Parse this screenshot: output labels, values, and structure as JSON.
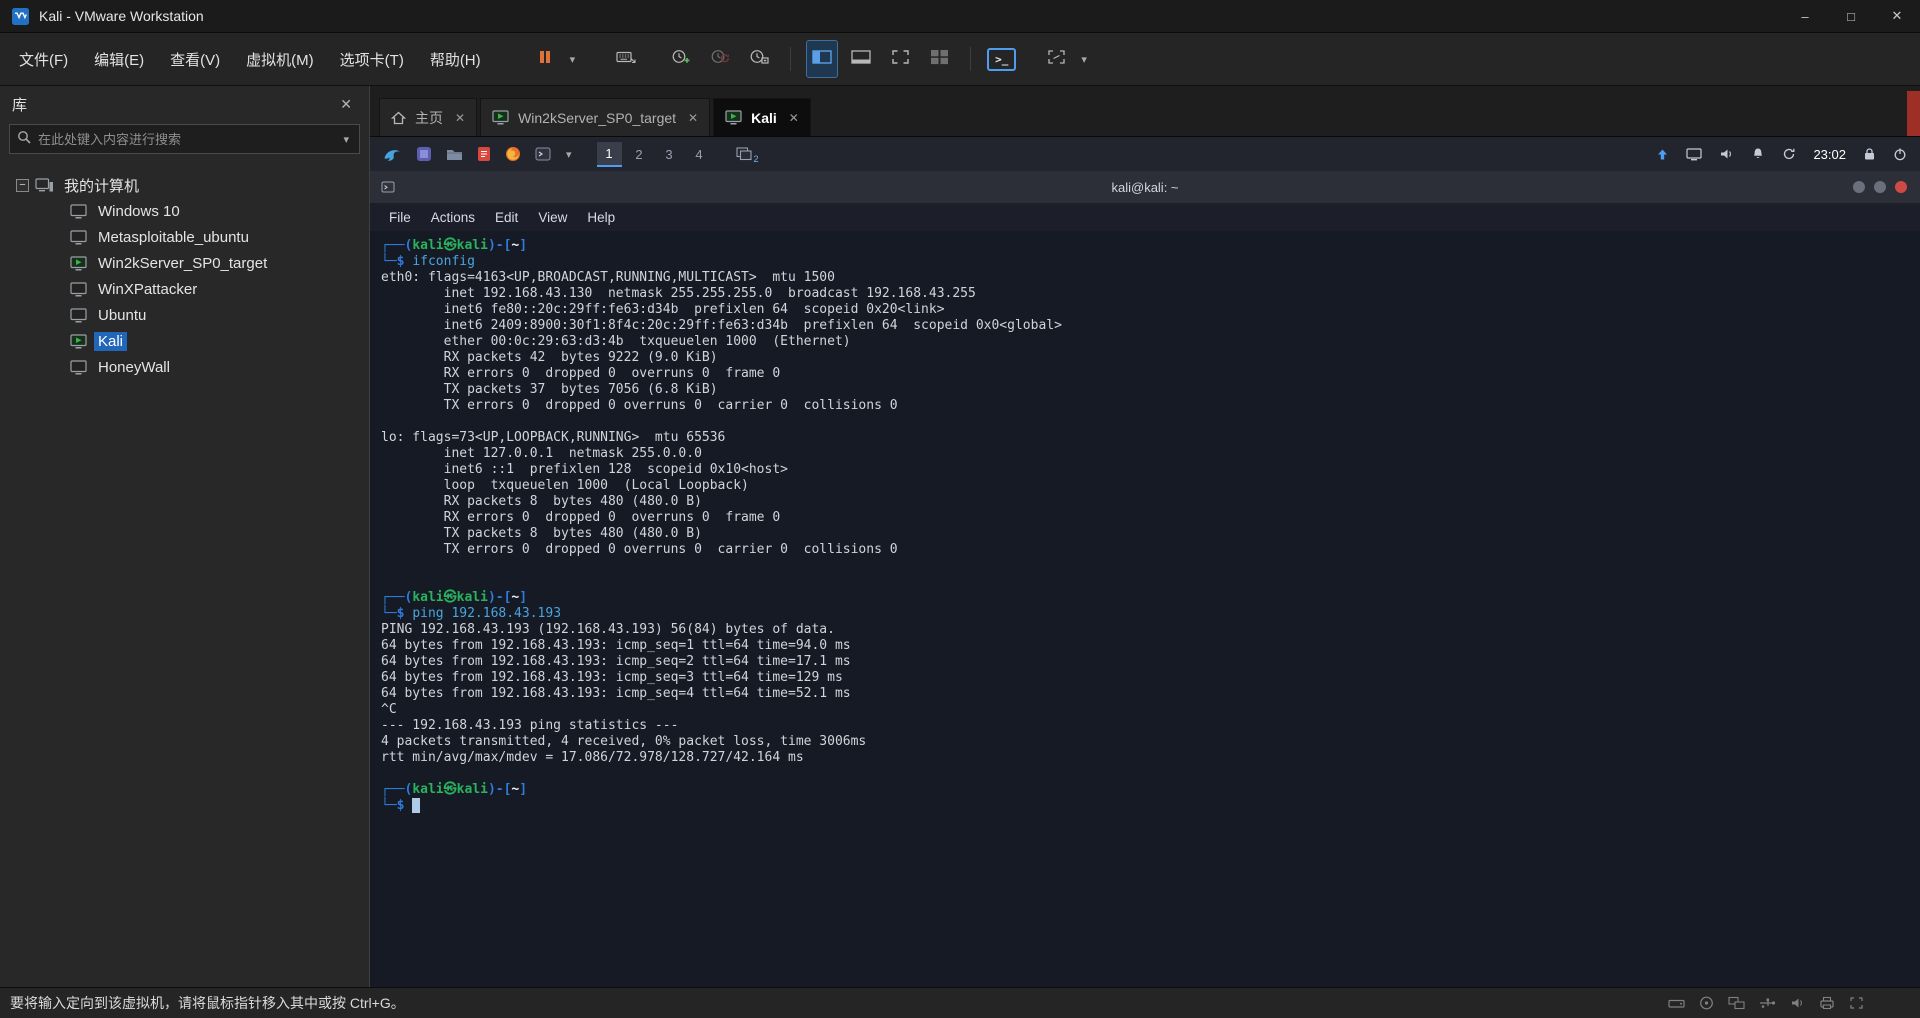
{
  "window": {
    "title": "Kali - VMware Workstation"
  },
  "icons": {
    "close": "✕",
    "minimize": "–",
    "maximize": "□",
    "dropdown": "▾",
    "expander": "−",
    "console": ">_"
  },
  "menubar": {
    "items": [
      {
        "name": "file",
        "label": "文件(F)"
      },
      {
        "name": "edit",
        "label": "编辑(E)"
      },
      {
        "name": "view",
        "label": "查看(V)"
      },
      {
        "name": "vm",
        "label": "虚拟机(M)"
      },
      {
        "name": "tabs",
        "label": "选项卡(T)"
      },
      {
        "name": "help",
        "label": "帮助(H)"
      }
    ]
  },
  "toolbar": {
    "buttons": [
      "suspend",
      "suspend-menu",
      "send-ctrl-alt-del",
      "take-snapshot",
      "revert-snapshot",
      "snapshot-manager",
      "show-library",
      "show-thumbnail-bar",
      "fit-guest",
      "unity-mode",
      "console-view",
      "fullscreen",
      "fullscreen-menu"
    ]
  },
  "sidebar": {
    "title": "库",
    "search_placeholder": "在此处键入内容进行搜索",
    "tree_root": "我的计算机",
    "items": [
      {
        "label": "Windows 10",
        "running": false,
        "selected": false
      },
      {
        "label": "Metasploitable_ubuntu",
        "running": false,
        "selected": false
      },
      {
        "label": "Win2kServer_SP0_target",
        "running": true,
        "selected": false
      },
      {
        "label": "WinXPattacker",
        "running": false,
        "selected": false
      },
      {
        "label": "Ubuntu",
        "running": false,
        "selected": false
      },
      {
        "label": "Kali",
        "running": true,
        "selected": true
      },
      {
        "label": "HoneyWall",
        "running": false,
        "selected": false
      }
    ]
  },
  "tabs": [
    {
      "name": "home",
      "label": "主页",
      "icon": "home",
      "active": false
    },
    {
      "name": "win2kserver-sp0-target",
      "label": "Win2kServer_SP0_target",
      "icon": "vm-running",
      "active": false
    },
    {
      "name": "kali",
      "label": "Kali",
      "icon": "vm-running",
      "active": true
    }
  ],
  "guest": {
    "panel": {
      "left_icon_names": [
        "kali-menu-icon",
        "workspaces-app-icon",
        "file-manager-icon",
        "text-editor-icon",
        "firefox-icon",
        "terminal-app-icon",
        "apps-chevron-icon",
        "window-list-icon"
      ],
      "right_icon_names": [
        "upload-icon",
        "display-icon",
        "volume-icon",
        "bell-icon",
        "update-icon",
        "lock-icon",
        "power-icon"
      ],
      "workspaces": [
        "1",
        "2",
        "3",
        "4"
      ],
      "active_workspace": "1",
      "window_badge": "2",
      "clock": "23:02"
    },
    "terminal": {
      "title": "kali@kali: ~",
      "menu": [
        "File",
        "Actions",
        "Edit",
        "View",
        "Help"
      ],
      "lines": [
        [
          [
            "b",
            "┌──("
          ],
          [
            "g",
            "kali㉿kali"
          ],
          [
            "b",
            ")-["
          ],
          [
            "w",
            "~"
          ],
          [
            "b",
            "]"
          ]
        ],
        [
          [
            "b",
            "└─$"
          ],
          [
            "o",
            " "
          ],
          [
            "c",
            "ifconfig"
          ]
        ],
        [
          [
            "o",
            "eth0: flags=4163<UP,BROADCAST,RUNNING,MULTICAST>  mtu 1500"
          ]
        ],
        [
          [
            "o",
            "        inet 192.168.43.130  netmask 255.255.255.0  broadcast 192.168.43.255"
          ]
        ],
        [
          [
            "o",
            "        inet6 fe80::20c:29ff:fe63:d34b  prefixlen 64  scopeid 0x20<link>"
          ]
        ],
        [
          [
            "o",
            "        inet6 2409:8900:30f1:8f4c:20c:29ff:fe63:d34b  prefixlen 64  scopeid 0x0<global>"
          ]
        ],
        [
          [
            "o",
            "        ether 00:0c:29:63:d3:4b  txqueuelen 1000  (Ethernet)"
          ]
        ],
        [
          [
            "o",
            "        RX packets 42  bytes 9222 (9.0 KiB)"
          ]
        ],
        [
          [
            "o",
            "        RX errors 0  dropped 0  overruns 0  frame 0"
          ]
        ],
        [
          [
            "o",
            "        TX packets 37  bytes 7056 (6.8 KiB)"
          ]
        ],
        [
          [
            "o",
            "        TX errors 0  dropped 0 overruns 0  carrier 0  collisions 0"
          ]
        ],
        [],
        [
          [
            "o",
            "lo: flags=73<UP,LOOPBACK,RUNNING>  mtu 65536"
          ]
        ],
        [
          [
            "o",
            "        inet 127.0.0.1  netmask 255.0.0.0"
          ]
        ],
        [
          [
            "o",
            "        inet6 ::1  prefixlen 128  scopeid 0x10<host>"
          ]
        ],
        [
          [
            "o",
            "        loop  txqueuelen 1000  (Local Loopback)"
          ]
        ],
        [
          [
            "o",
            "        RX packets 8  bytes 480 (480.0 B)"
          ]
        ],
        [
          [
            "o",
            "        RX errors 0  dropped 0  overruns 0  frame 0"
          ]
        ],
        [
          [
            "o",
            "        TX packets 8  bytes 480 (480.0 B)"
          ]
        ],
        [
          [
            "o",
            "        TX errors 0  dropped 0 overruns 0  carrier 0  collisions 0"
          ]
        ],
        [],
        [],
        [
          [
            "b",
            "┌──("
          ],
          [
            "g",
            "kali㉿kali"
          ],
          [
            "b",
            ")-["
          ],
          [
            "w",
            "~"
          ],
          [
            "b",
            "]"
          ]
        ],
        [
          [
            "b",
            "└─$"
          ],
          [
            "o",
            " "
          ],
          [
            "c",
            "ping 192.168.43.193"
          ]
        ],
        [
          [
            "o",
            "PING 192.168.43.193 (192.168.43.193) 56(84) bytes of data."
          ]
        ],
        [
          [
            "o",
            "64 bytes from 192.168.43.193: icmp_seq=1 ttl=64 time=94.0 ms"
          ]
        ],
        [
          [
            "o",
            "64 bytes from 192.168.43.193: icmp_seq=2 ttl=64 time=17.1 ms"
          ]
        ],
        [
          [
            "o",
            "64 bytes from 192.168.43.193: icmp_seq=3 ttl=64 time=129 ms"
          ]
        ],
        [
          [
            "o",
            "64 bytes from 192.168.43.193: icmp_seq=4 ttl=64 time=52.1 ms"
          ]
        ],
        [
          [
            "o",
            "^C"
          ]
        ],
        [
          [
            "o",
            "--- 192.168.43.193 ping statistics ---"
          ]
        ],
        [
          [
            "o",
            "4 packets transmitted, 4 received, 0% packet loss, time 3006ms"
          ]
        ],
        [
          [
            "o",
            "rtt min/avg/max/mdev = 17.086/72.978/128.727/42.164 ms"
          ]
        ],
        [],
        [
          [
            "b",
            "┌──("
          ],
          [
            "g",
            "kali㉿kali"
          ],
          [
            "b",
            ")-["
          ],
          [
            "w",
            "~"
          ],
          [
            "b",
            "]"
          ]
        ],
        [
          [
            "b",
            "└─$"
          ],
          [
            "o",
            " "
          ],
          [
            "cur",
            " "
          ]
        ]
      ]
    }
  },
  "statusbar": {
    "message": "要将输入定向到该虚拟机，请将鼠标指针移入其中或按 Ctrl+G。",
    "device_icon_names": [
      "hdd-icon",
      "cdrom-icon",
      "network-adapter-icon",
      "usb-icon",
      "sound-icon",
      "printer-icon",
      "fit-screen-icon"
    ]
  }
}
